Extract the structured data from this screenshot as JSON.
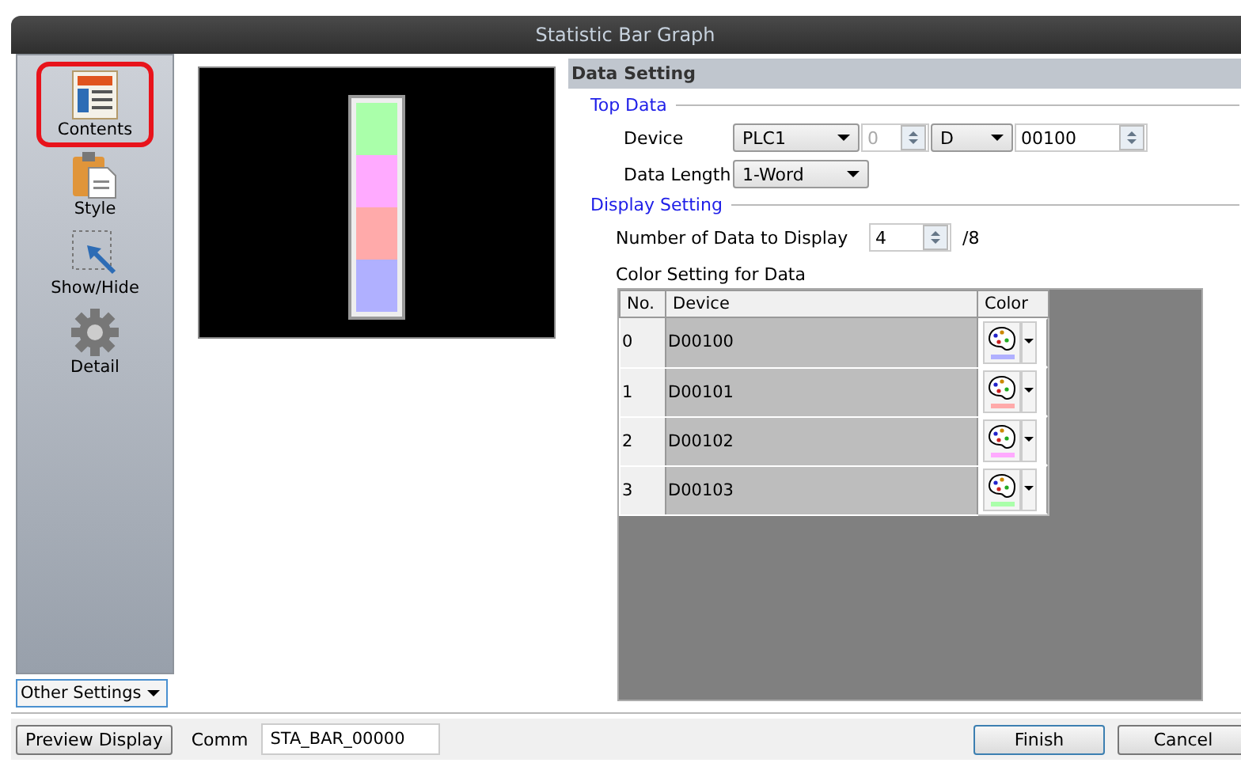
{
  "window": {
    "title": "Statistic Bar Graph"
  },
  "sidebar": {
    "items": [
      {
        "label": "Contents",
        "kind": "contents",
        "selected": true
      },
      {
        "label": "Style",
        "kind": "style",
        "selected": false
      },
      {
        "label": "Show/Hide",
        "kind": "showhide",
        "selected": false
      },
      {
        "label": "Detail",
        "kind": "detail",
        "selected": false
      }
    ],
    "other_settings": "Other Settings"
  },
  "panel": {
    "title": "Data Setting",
    "top_data": {
      "heading": "Top Data",
      "device_label": "Device",
      "plc": "PLC1",
      "station": "0",
      "device_type": "D",
      "address": "00100",
      "length_label": "Data Length",
      "length": "1-Word"
    },
    "display_setting": {
      "heading": "Display Setting",
      "count_label": "Number of Data to Display",
      "count": "4",
      "max": "/8",
      "color_label": "Color Setting for Data"
    },
    "table": {
      "columns": [
        "No.",
        "Device",
        "Color"
      ],
      "rows": [
        {
          "no": "0",
          "device": "D00100",
          "color": "#b0b0ff"
        },
        {
          "no": "1",
          "device": "D00101",
          "color": "#ffaaaa"
        },
        {
          "no": "2",
          "device": "D00102",
          "color": "#ffaaff"
        },
        {
          "no": "3",
          "device": "D00103",
          "color": "#aaffaa"
        }
      ]
    }
  },
  "footer": {
    "preview": "Preview Display",
    "comment_label": "Comm",
    "comment": "STA_BAR_00000",
    "buttons": [
      "Finish",
      "Cancel"
    ]
  }
}
